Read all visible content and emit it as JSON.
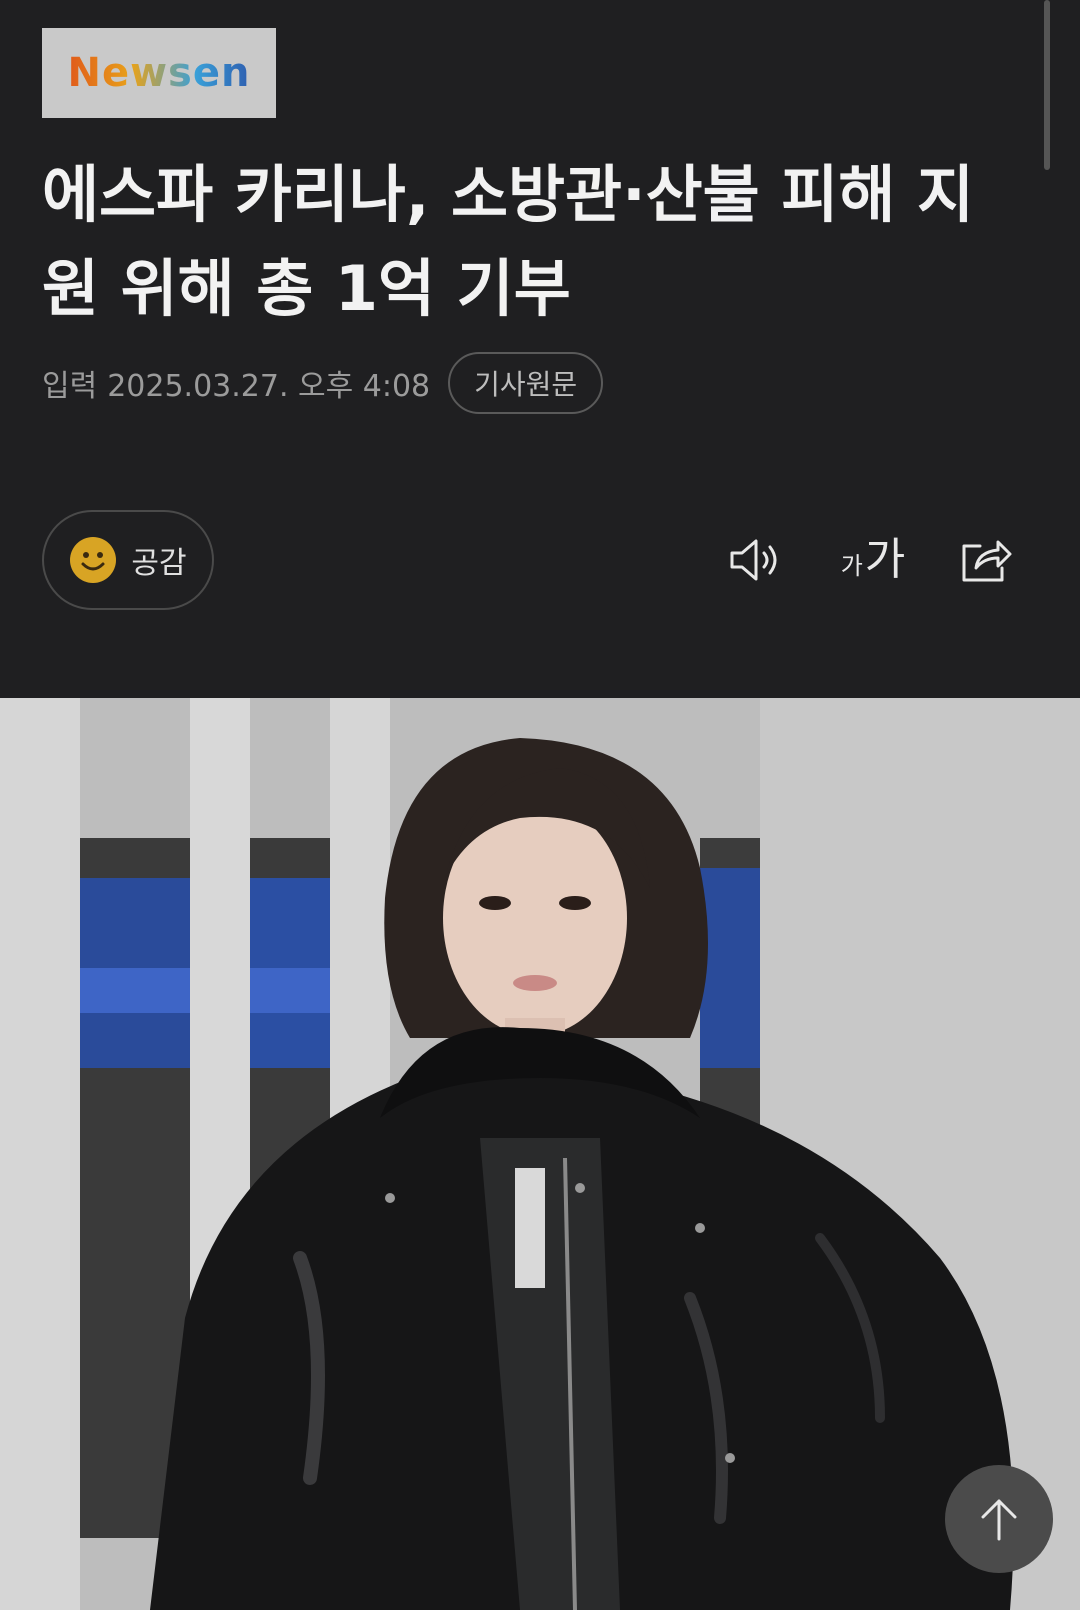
{
  "brand": {
    "logo_text": "Newsen"
  },
  "article": {
    "title": "에스파 카리나, 소방관·산불 피해 지원 위해 총 1억 기부",
    "published_label": "입력",
    "published_at": "2025.03.27. 오후 4:08",
    "original_link_label": "기사원문"
  },
  "actions": {
    "like_label": "공감",
    "font_size_small": "가",
    "font_size_large": "가"
  },
  "icons": {
    "like": "smiley-icon",
    "listen": "speaker-icon",
    "share": "share-icon",
    "top": "arrow-up-icon"
  },
  "colors": {
    "background": "#1f1f21",
    "smiley": "#d8a424"
  }
}
